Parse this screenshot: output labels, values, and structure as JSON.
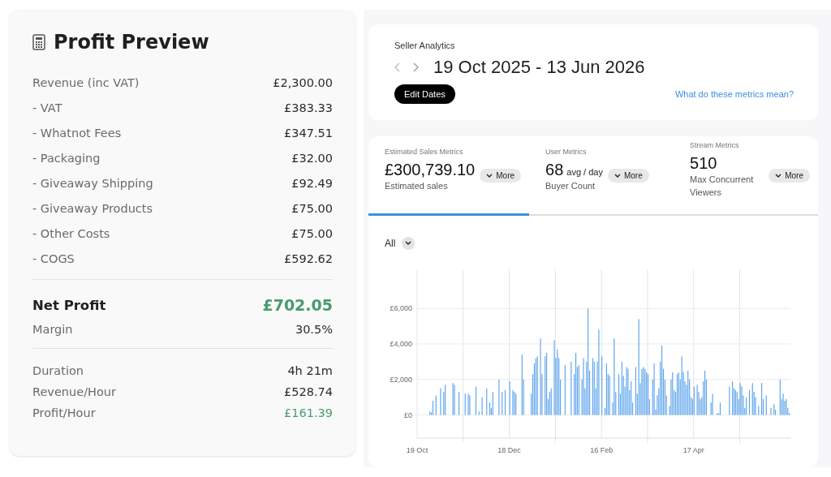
{
  "profit_preview": {
    "title": "Profit Preview",
    "sections": [
      {
        "rows": [
          {
            "label": "Revenue (inc VAT)",
            "value": "£2,300.00",
            "kind": "line",
            "positive": false
          },
          {
            "label": "- VAT",
            "value": "£383.33",
            "kind": "line",
            "positive": false
          },
          {
            "label": "- Whatnot Fees",
            "value": "£347.51",
            "kind": "line",
            "positive": false
          },
          {
            "label": "- Packaging",
            "value": "£32.00",
            "kind": "line",
            "positive": false
          },
          {
            "label": "- Giveaway Shipping",
            "value": "£92.49",
            "kind": "line",
            "positive": false
          },
          {
            "label": "- Giveaway Products",
            "value": "£75.00",
            "kind": "line",
            "positive": false
          },
          {
            "label": "- Other Costs",
            "value": "£75.00",
            "kind": "line",
            "positive": false
          },
          {
            "label": "- COGS",
            "value": "£592.62",
            "kind": "line",
            "positive": false
          }
        ]
      },
      {
        "rows": [
          {
            "label": "Net Profit",
            "value": "£702.05",
            "kind": "total",
            "positive": true
          },
          {
            "label": "Margin",
            "value": "30.5%",
            "kind": "compact",
            "positive": false
          }
        ]
      },
      {
        "rows": [
          {
            "label": "Duration",
            "value": "4h 21m",
            "kind": "compact",
            "positive": false
          },
          {
            "label": "Revenue/Hour",
            "value": "£528.74",
            "kind": "compact",
            "positive": false
          },
          {
            "label": "Profit/Hour",
            "value": "£161.39",
            "kind": "compact",
            "positive": true
          }
        ]
      }
    ]
  },
  "analytics": {
    "title": "Seller Analytics",
    "date_range": "19 Oct 2025 - 13 Jun 2026",
    "edit_button": "Edit Dates",
    "help_link": "What do these metrics mean?",
    "metric_tabs": [
      {
        "heading": "Estimated Sales Metrics",
        "value": "£300,739.10",
        "sublabel": "Estimated sales",
        "more": "More",
        "selected": true
      },
      {
        "heading": "User Metrics",
        "value": "68",
        "unit": "avg / day",
        "sublabel": "Buyer Count",
        "more": "More",
        "selected": false
      },
      {
        "heading": "Stream Metrics",
        "value": "510",
        "sublabel": "Max Concurrent Viewers",
        "more": "More",
        "selected": false
      }
    ],
    "filter": "All",
    "chart_data": {
      "type": "bar",
      "grid": true,
      "ylim": [
        -1300,
        8200
      ],
      "yticks": [
        {
          "value": 0,
          "label": "£0"
        },
        {
          "value": 2000,
          "label": "£2,000"
        },
        {
          "value": 4000,
          "label": "£4,000"
        },
        {
          "value": 6000,
          "label": "£6,000"
        }
      ],
      "categories": [
        "19 Oct",
        null,
        null,
        null,
        null,
        null,
        null,
        null,
        null,
        null,
        null,
        null,
        null,
        null,
        null,
        null,
        null,
        null,
        null,
        null,
        null,
        null,
        null,
        null,
        null,
        null,
        null,
        null,
        null,
        null,
        null,
        null,
        null,
        null,
        null,
        null,
        null,
        null,
        null,
        null,
        null,
        null,
        null,
        null,
        null,
        null,
        null,
        null,
        null,
        null,
        null,
        null,
        null,
        null,
        null,
        null,
        null,
        null,
        null,
        null,
        "18 Dec",
        null,
        null,
        null,
        null,
        null,
        null,
        null,
        null,
        null,
        null,
        null,
        null,
        null,
        null,
        null,
        null,
        null,
        null,
        null,
        null,
        null,
        null,
        null,
        null,
        null,
        null,
        null,
        null,
        null,
        null,
        null,
        null,
        null,
        null,
        null,
        null,
        null,
        null,
        null,
        null,
        null,
        null,
        null,
        null,
        null,
        null,
        null,
        null,
        null,
        null,
        null,
        null,
        null,
        null,
        null,
        null,
        null,
        null,
        null,
        "16 Feb",
        null,
        null,
        null,
        null,
        null,
        null,
        null,
        null,
        null,
        null,
        null,
        null,
        null,
        null,
        null,
        null,
        null,
        null,
        null,
        null,
        null,
        null,
        null,
        null,
        null,
        null,
        null,
        null,
        null,
        null,
        null,
        null,
        null,
        null,
        null,
        null,
        null,
        null,
        null,
        null,
        null,
        null,
        null,
        null,
        null,
        null,
        null,
        null,
        null,
        null,
        null,
        null,
        null,
        null,
        null,
        null,
        null,
        null,
        null,
        "17 Apr",
        null,
        null,
        null,
        null,
        null,
        null,
        null,
        null,
        null,
        null,
        null,
        null,
        null,
        null,
        null,
        null,
        null,
        null,
        null,
        null,
        null,
        null,
        null,
        null,
        null,
        null,
        null,
        null,
        null,
        null,
        null,
        null,
        null,
        null,
        null,
        null,
        null,
        null,
        null,
        null,
        null,
        null,
        null,
        null,
        null,
        null,
        null,
        null,
        null,
        null,
        null,
        null,
        null,
        null,
        null,
        null,
        null,
        null,
        null,
        null,
        null,
        null
      ],
      "series": [
        {
          "color": "#5ba3eb",
          "values": [
            0,
            0,
            0,
            0,
            0,
            0,
            0,
            0,
            200,
            150,
            800,
            0,
            1100,
            0,
            0,
            1500,
            0,
            1300,
            1700,
            0,
            0,
            0,
            0,
            1800,
            1700,
            0,
            0,
            1300,
            0,
            0,
            0,
            1200,
            0,
            1200,
            1100,
            0,
            0,
            0,
            1600,
            0,
            200,
            0,
            1000,
            0,
            0,
            1500,
            0,
            700,
            400,
            1300,
            0,
            0,
            0,
            2000,
            0,
            1300,
            0,
            1400,
            0,
            0,
            1900,
            0,
            1400,
            1300,
            1200,
            0,
            0,
            0,
            3400,
            2000,
            0,
            0,
            0,
            0,
            1200,
            2300,
            2900,
            3200,
            3300,
            0,
            4300,
            2300,
            0,
            3300,
            3500,
            900,
            1300,
            1500,
            0,
            4200,
            3200,
            3700,
            3200,
            2000,
            0,
            0,
            2800,
            0,
            0,
            0,
            3000,
            0,
            2300,
            3500,
            2700,
            2800,
            0,
            2000,
            3200,
            1500,
            3000,
            6000,
            2500,
            0,
            3200,
            3000,
            1500,
            3000,
            4800,
            0,
            3300,
            0,
            400,
            2900,
            2300,
            2200,
            0,
            700,
            4300,
            1300,
            0,
            2300,
            1200,
            3000,
            2200,
            1600,
            2700,
            2600,
            1400,
            1900,
            700,
            0,
            2700,
            1200,
            5400,
            1800,
            2600,
            2700,
            2600,
            2400,
            2300,
            900,
            0,
            2000,
            2900,
            300,
            1100,
            1500,
            3000,
            3900,
            2600,
            2000,
            1100,
            0,
            500,
            2000,
            2400,
            1400,
            1300,
            2300,
            2400,
            2000,
            3300,
            2400,
            1900,
            1700,
            2500,
            2000,
            1000,
            900,
            1600,
            0,
            1700,
            1300,
            900,
            1000,
            1900,
            2500,
            2000,
            0,
            0,
            700,
            1200,
            0,
            0,
            100,
            100,
            700,
            0,
            0,
            0,
            0,
            0,
            1600,
            0,
            1900,
            1500,
            1400,
            1300,
            900,
            1800,
            1600,
            1100,
            400,
            1000,
            0,
            1400,
            0,
            1800,
            1300,
            1000,
            0,
            500,
            0,
            1800,
            900,
            0,
            1100,
            0,
            0,
            400,
            0,
            600,
            300,
            0,
            0,
            2000,
            900,
            1200,
            800,
            900,
            400,
            100
          ]
        }
      ]
    }
  }
}
